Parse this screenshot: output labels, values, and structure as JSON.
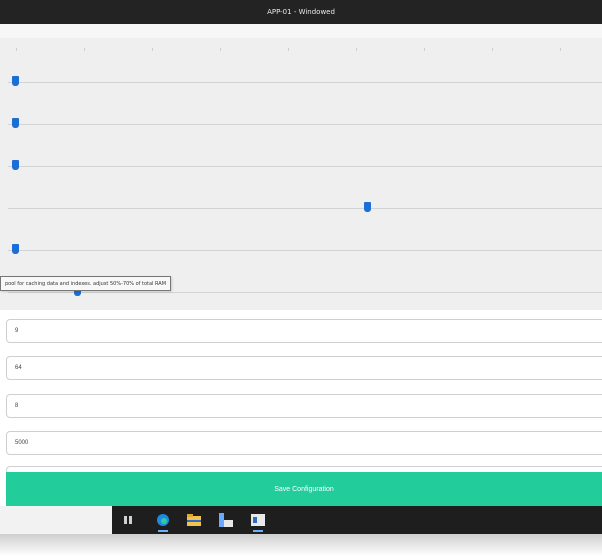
{
  "window": {
    "title": "APP-01 - Windowed"
  },
  "sliders": [
    {
      "name": "slider-1",
      "value_fraction": 0.0
    },
    {
      "name": "slider-2",
      "value_fraction": 0.0
    },
    {
      "name": "slider-3",
      "value_fraction": 0.0
    },
    {
      "name": "slider-4",
      "value_fraction": 0.0
    },
    {
      "name": "slider-5",
      "value_fraction": 0.6
    },
    {
      "name": "slider-6",
      "value_fraction": 0.0
    },
    {
      "name": "slider-7",
      "value_fraction": 0.12
    }
  ],
  "tooltip": {
    "text": "pool for caching data and indexes. adjust 50%-70% of total RAM"
  },
  "fields": [
    {
      "value": "9"
    },
    {
      "value": "64"
    },
    {
      "value": "8"
    },
    {
      "value": "5000"
    }
  ],
  "save_button": {
    "label": "Save Configuration",
    "color": "#22cc9b"
  },
  "taskbar": {
    "icons": [
      "task-view-icon",
      "edge-browser-icon",
      "file-explorer-icon",
      "app-icon",
      "active-window-icon"
    ]
  }
}
